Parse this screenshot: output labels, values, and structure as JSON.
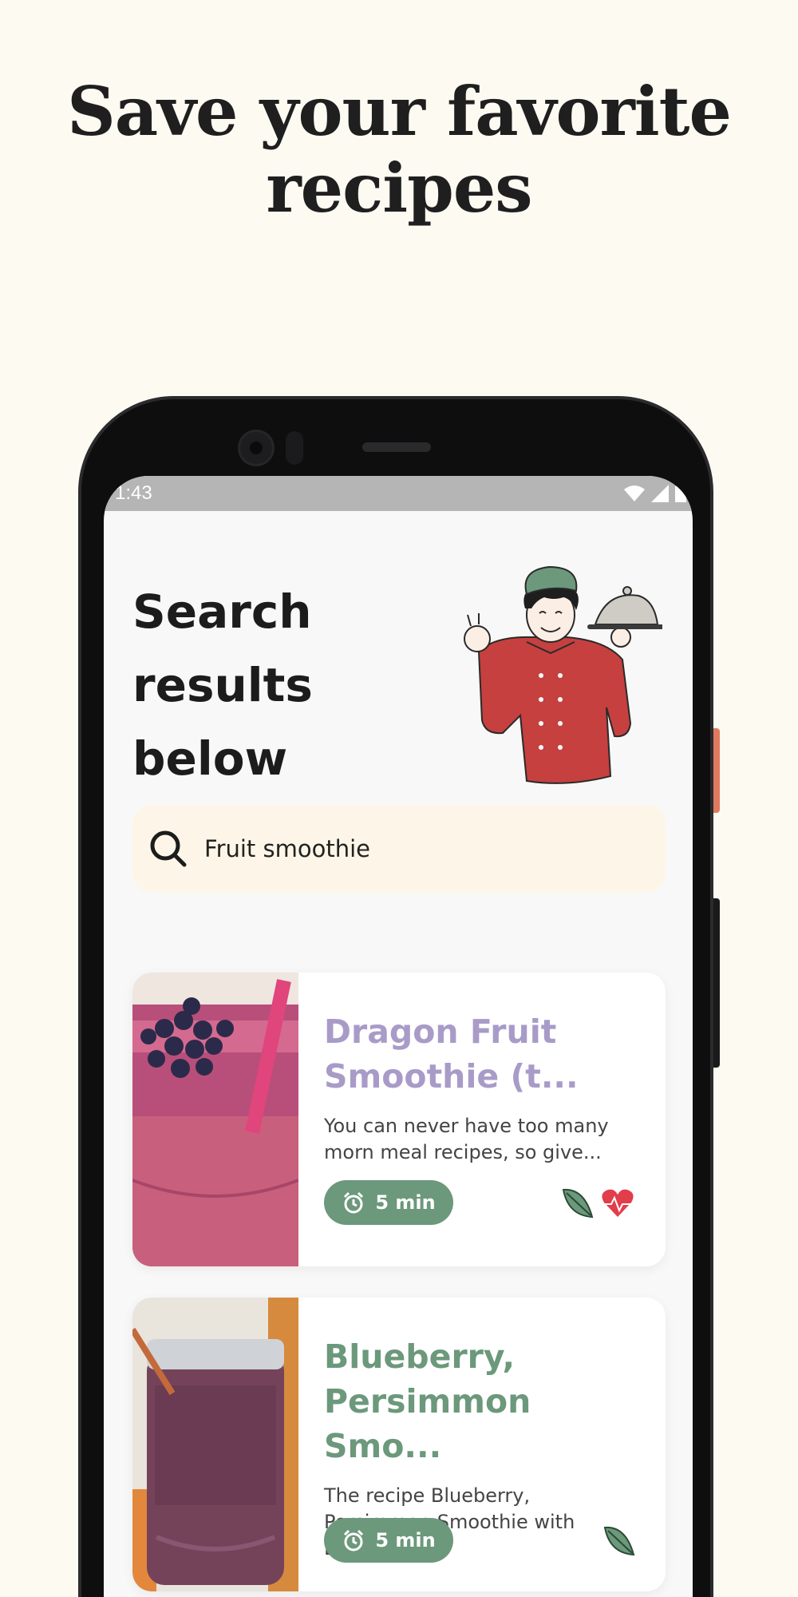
{
  "headline": {
    "line1": "Save your favorite",
    "line2": "recipes"
  },
  "statusbar": {
    "time": "1:43"
  },
  "page": {
    "title_line1": "Search",
    "title_line2": "results",
    "title_line3": "below"
  },
  "search": {
    "value": "Fruit smoothie"
  },
  "results": [
    {
      "title": "Dragon Fruit\nSmoothie (t...",
      "title_color": "#a99bc8",
      "description": "You can never have too many\nmorn meal recipes, so give...",
      "time": "5 min",
      "tags": [
        "leaf-icon",
        "heart-pulse-icon"
      ]
    },
    {
      "title": "Blueberry,\nPersimmon Smo...",
      "title_color": "#6c987b",
      "description": "The recipe Blueberry,\nPersimmon Smoothie with\nBananan ...",
      "time": "5 min",
      "tags": [
        "leaf-icon"
      ]
    }
  ],
  "colors": {
    "accent_green": "#6c987b",
    "accent_orange": "#e07a5f",
    "heart": "#e23d4b"
  }
}
